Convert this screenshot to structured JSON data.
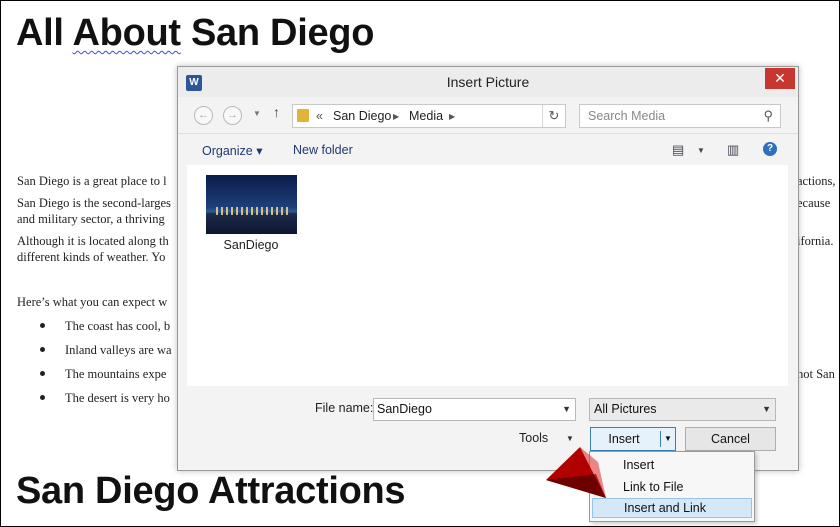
{
  "document": {
    "title_part1": "All ",
    "title_part2": "About",
    "title_part3": " San Diego",
    "p1": "San Diego is a great place to l",
    "p1_right": "actions,",
    "p2a": "San Diego is the second-larges",
    "p2a_right": "ecause",
    "p2b": "and military sector, a thriving",
    "p3a": "Although it is located along th",
    "p3a_right": "ifornia.",
    "p3b": "different kinds of weather. Yo",
    "intro": "Here’s what you can expect w",
    "bullets": [
      {
        "left": "The coast has cool, b",
        "right": ""
      },
      {
        "left": "Inland valleys are wa",
        "right": ""
      },
      {
        "left": "The mountains expe",
        "right": "hot San"
      },
      {
        "left": "The desert is very ho",
        "right": ""
      }
    ],
    "heading2": "San Diego Attractions"
  },
  "dialog": {
    "title": "Insert Picture",
    "app_icon_letter": "W",
    "close_glyph": "✕",
    "breadcrumb": {
      "overflow": "«",
      "items": [
        "San Diego",
        "Media"
      ],
      "separator": "▶"
    },
    "search_placeholder": "Search Media",
    "toolbar": {
      "organize": "Organize ▾",
      "new_folder": "New folder",
      "help": "?"
    },
    "files": [
      {
        "name": "SanDiego"
      }
    ],
    "file_name_label": "File name:",
    "file_name_value": "SanDiego",
    "file_type_value": "All Pictures",
    "tools_label": "Tools",
    "insert_label": "Insert",
    "cancel_label": "Cancel"
  },
  "insert_menu": {
    "items": [
      "Insert",
      "Link to File",
      "Insert and Link"
    ],
    "highlighted_index": 2
  },
  "colors": {
    "close": "#c7362f",
    "accent": "#3c7fb1",
    "highlight": "#d5e8f7",
    "arrow": "#b00000"
  }
}
